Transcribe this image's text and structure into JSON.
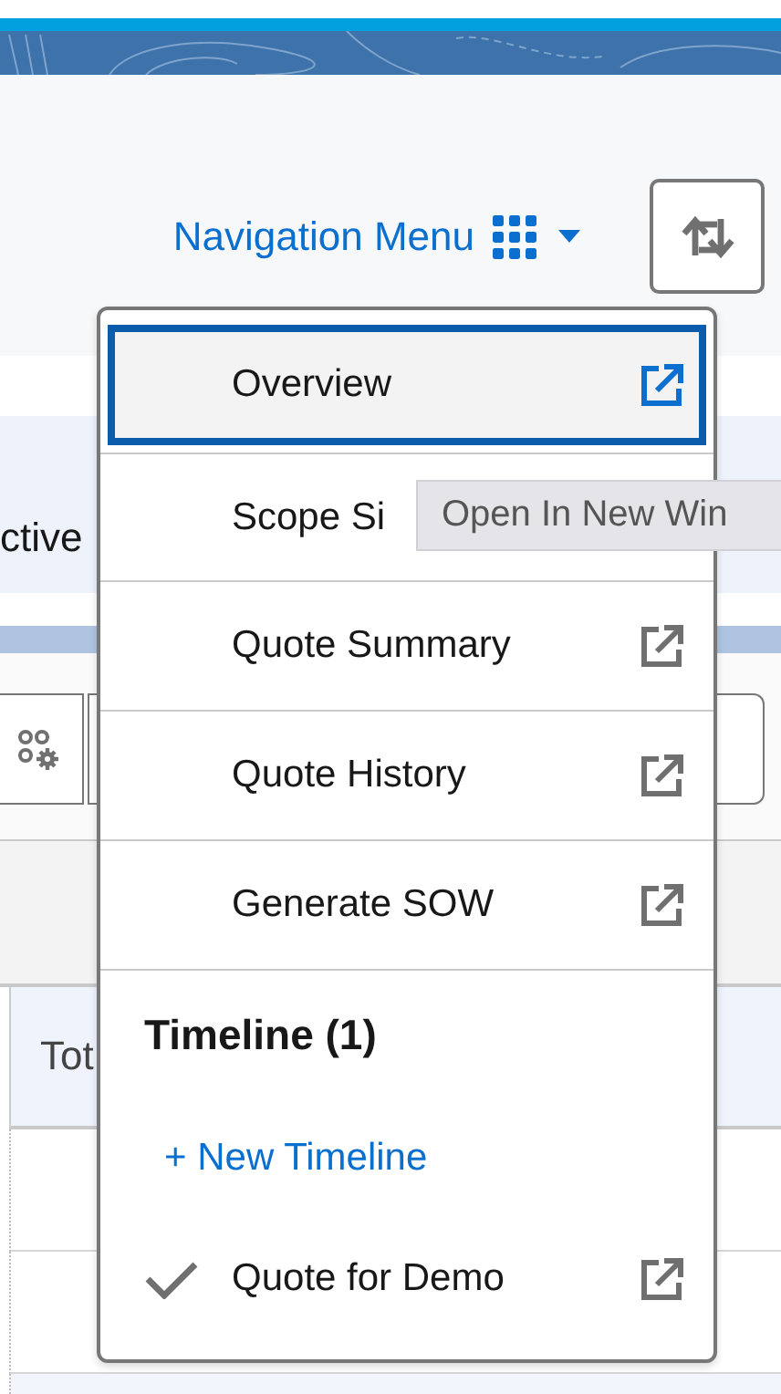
{
  "nav_menu": {
    "label": "Navigation Menu",
    "expanded": true
  },
  "background": {
    "tab_text": "ctive",
    "table_columns": [
      "Tot"
    ]
  },
  "menu": {
    "items": [
      {
        "label": "Overview",
        "selected": true,
        "link_icon": true
      },
      {
        "label": "Scope Si",
        "selected": false,
        "link_icon": false
      },
      {
        "label": "Quote Summary",
        "selected": false,
        "link_icon": true
      },
      {
        "label": "Quote History",
        "selected": false,
        "link_icon": true
      },
      {
        "label": "Generate SOW",
        "selected": false,
        "link_icon": true
      }
    ],
    "section": {
      "title": "Timeline (1)",
      "action": "+ New Timeline",
      "items": [
        {
          "label": "Quote for Demo",
          "checked": true
        }
      ]
    }
  },
  "tooltip": {
    "text": "Open In New Win"
  }
}
